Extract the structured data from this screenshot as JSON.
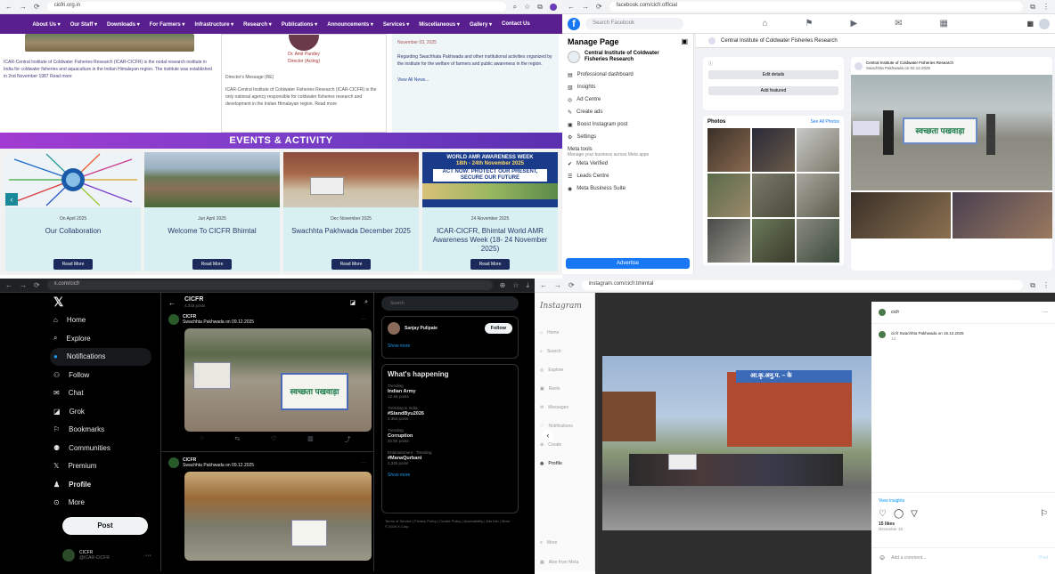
{
  "q1": {
    "url": "ciofri.org.in",
    "nav": [
      "About Us ▾",
      "Our Staff ▾",
      "Downloads ▾",
      "For Farmers ▾",
      "Infrastructure ▾",
      "Research ▾",
      "Publications ▾",
      "Announcements ▾",
      "Services ▾",
      "Miscellaneous ▾",
      "Gallery ▾",
      "Contact Us"
    ],
    "director_name": "Dr. Amit Pandey",
    "director_title": "Director (Acting)",
    "col_a_text": "ICAR-Central Institute of Coldwater Fisheries Research (ICAR-CICFR) is the nodal research institute in India for coldwater fisheries and aquaculture in the Indian Himalayan region. The institute was established in 2nd November 1987 Read more",
    "col_b_heading": "Director's Message (RE)",
    "col_b_text": "ICAR-Central Institute of Coldwater Fisheries Research (ICAR-CICFR) is the only national agency responsible for coldwater fisheries research and development in the Indian Himalayan region. Read more",
    "col_c_date": "November 03, 2025",
    "col_c_text": "Regarding Swachhata Pakhwada and other institutional activities organized by the institute for the welfare of farmers and public awareness in the region.",
    "col_c_link": "View All News...",
    "events_title": "EVENTS & ACTIVITY",
    "cards": [
      {
        "date": "On April 2025",
        "title": "Our Collaboration",
        "btn": "Read More"
      },
      {
        "date": "Jun April 2025",
        "title": "Welcome To CICFR Bhimtal",
        "btn": "Read More"
      },
      {
        "date": "Dec November 2025",
        "title": "Swachhta Pakhwada December 2025",
        "btn": "Read More"
      },
      {
        "date": "24 November 2025",
        "title": "ICAR-CICFR, Bhimtal World AMR Awareness Week (18- 24 November 2025)",
        "btn": "Read More"
      }
    ],
    "poster_line1": "WORLD AMR AWARENESS WEEK",
    "poster_line2": "18th - 24th November 2025",
    "poster_line3": "ACT NOW: PROTECT OUR PRESENT, SECURE OUR FUTURE"
  },
  "q2": {
    "url": "facebook.com/cicfr.official",
    "search_placeholder": "Search Facebook",
    "manage_page": "Manage Page",
    "page_name": "Central Institute of Coldwater Fisheries Research",
    "side_items": [
      "Professional dashboard",
      "Insights",
      "Ad Centre",
      "Create ads",
      "Boost Instagram post",
      "Settings"
    ],
    "meta_tools": "Meta tools",
    "meta_tools_sub": "Manage your business across Meta apps",
    "side_items2": [
      "Meta Verified",
      "Leads Centre",
      "Meta Business Suite"
    ],
    "advertise_btn": "Advertise",
    "header_title": "Central Institute of Coldwater Fisheries Research",
    "post_title": "Central Institute of Coldwater Fisheries Research",
    "post_caption": "Swachhta Pakhwada on 02.12.2025",
    "photos_title": "Photos",
    "see_all": "See All Photos",
    "intro_btn1": "Edit details",
    "intro_btn2": "Add featured",
    "poster_big": "स्वच्छता पखवाड़ा"
  },
  "q3": {
    "url": "x.com/cicfr",
    "nav": [
      "Home",
      "Explore",
      "Notifications",
      "Follow",
      "Chat",
      "Grok",
      "Bookmarks",
      "Communities",
      "Premium",
      "Profile",
      "More"
    ],
    "post_btn": "Post",
    "profile_name": "CICFR",
    "profile_handle": "@ICAR-CICFR",
    "header_name": "CICFR",
    "header_sub": "4,318 posts",
    "tweet1_author": "CICFR",
    "tweet1_text": "Swachhta Pakhwada on 09.12.2025",
    "tweet2_author": "CICFR",
    "tweet2_text": "Swachhta Pakhwada on 09.12.2025",
    "search_placeholder": "Search",
    "follow_name": "Sanjay Pulipate",
    "follow_btn": "Follow",
    "show_more": "Show more",
    "happening_title": "What's happening",
    "trends": [
      {
        "meta": "Trending",
        "name": "Indian Army",
        "count": "12.4K posts"
      },
      {
        "meta": "Trending in India",
        "name": "#StandByu2026",
        "count": "2,354 posts"
      },
      {
        "meta": "Trending",
        "name": "Corruption",
        "count": "22.5K posts"
      },
      {
        "meta": "Entertainment · Trending",
        "name": "#ManaQurbani",
        "count": "2,345 posts"
      }
    ],
    "footer": "Terms of Service | Privacy Policy | Cookie Policy | Accessibility | Ads info | More · © 2025 X Corp.",
    "poster_text": "स्वच्छता पखवाड़ा"
  },
  "q4": {
    "url": "instagram.com/cicfr.bhimtal",
    "logo": "Instagram",
    "side_items": [
      "Home",
      "Search",
      "Explore",
      "Reels",
      "Messages",
      "Notifications",
      "Create",
      "Profile"
    ],
    "side_bottom": [
      "More",
      "Also from Meta"
    ],
    "account": "cicfr",
    "caption": "cicfr Swachhta Pakhwada on 15.12.2025",
    "caption_time": "1d",
    "view_insights": "View insights",
    "likes": "15 likes",
    "date": "December 15",
    "comment_placeholder": "Add a comment...",
    "post_btn": "Post",
    "building_sign": "आ.कृ.अनु.प. – के"
  }
}
